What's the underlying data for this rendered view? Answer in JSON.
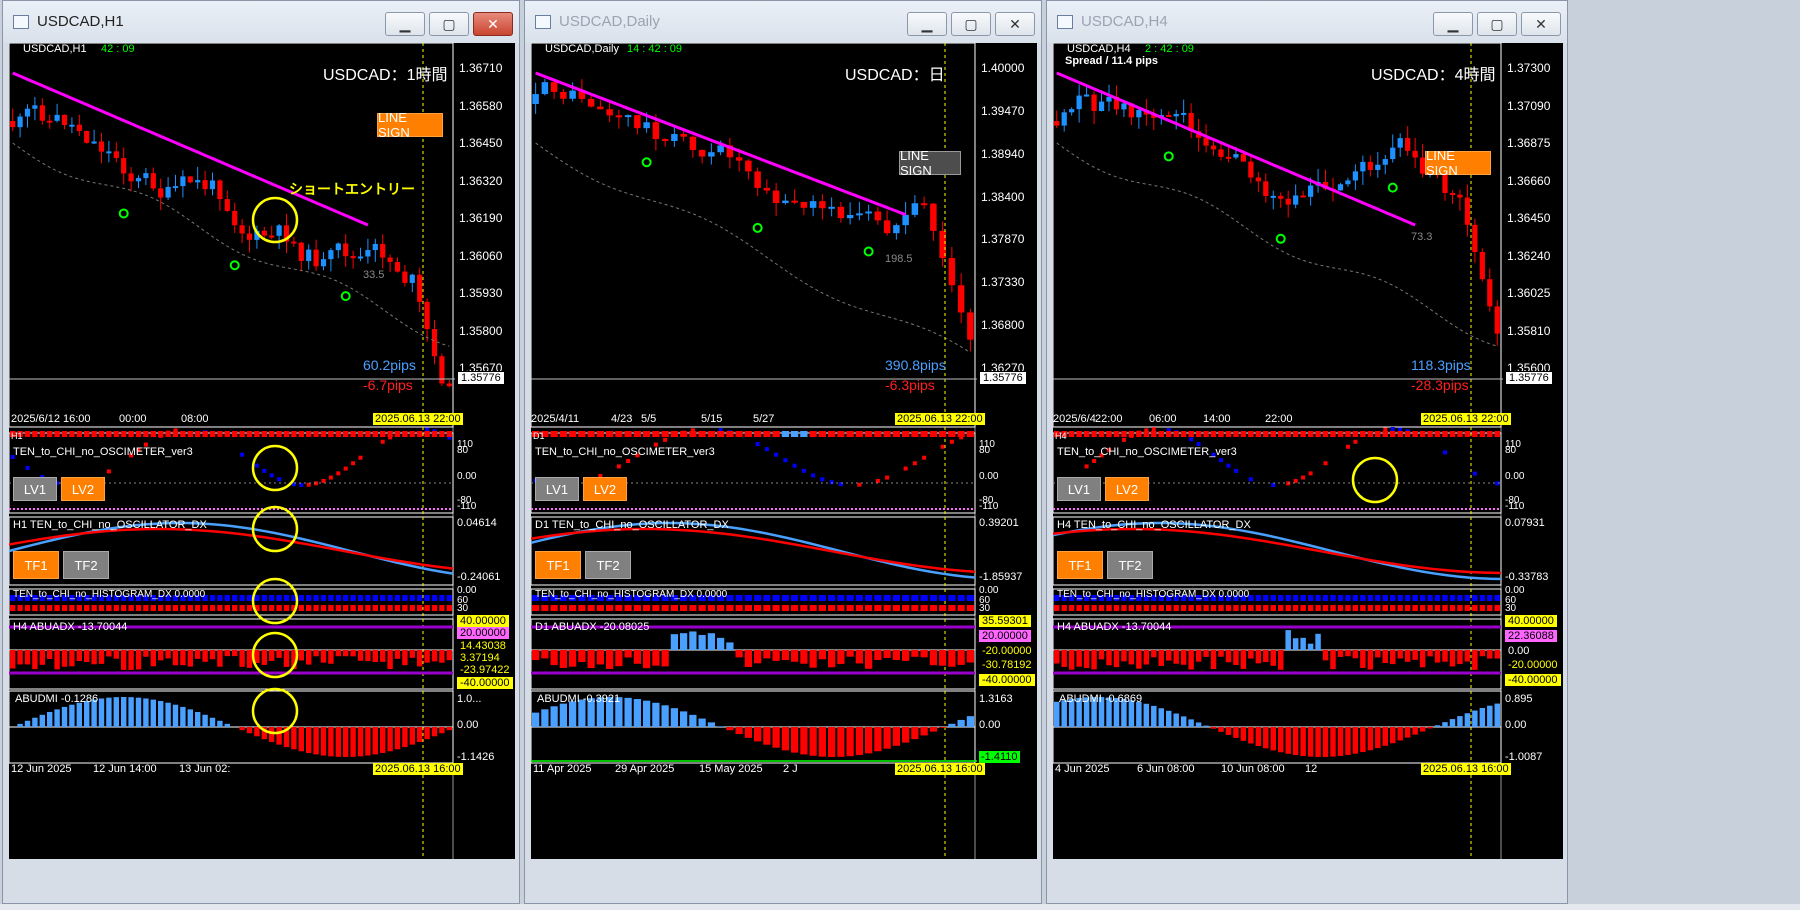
{
  "colors": {
    "bg": "#000000",
    "bull": "#1e90ff",
    "bear": "#ff0000",
    "ma": "#ff00ff",
    "date_highlight": "#ffff00",
    "lvl_btn": "#ff7f00",
    "gray_btn": "#808080"
  },
  "icons": [
    "window-icon",
    "minimize-icon",
    "maximize-icon",
    "close-icon"
  ],
  "windows": [
    {
      "title": "USDCAD,H1",
      "symbol": "USDCAD,H1",
      "timer": "42 : 09",
      "spread": "",
      "label": "USDCAD：1時間",
      "line_sign": "LINE SIGN",
      "line_sign_active": true,
      "yticks": [
        "1.36710",
        "1.36580",
        "1.36450",
        "1.36320",
        "1.36190",
        "1.36060",
        "1.35930",
        "1.35800",
        "1.35670"
      ],
      "price_box": "1.35776",
      "range_text": "33.5",
      "pips_blue": "60.2pips",
      "pips_red": "-6.7pips",
      "annotation": "ショートエントリー",
      "xticks": [
        "2025/6/12 16:00",
        "00:00",
        "08:00"
      ],
      "date_main": "2025.06.13 22:00",
      "tf_label": "H1",
      "osc_title": "TEN_to_CHI_no_OSCIMETER_ver3",
      "osc_yticks": [
        "110",
        "80",
        "0.00",
        "-80",
        "-110"
      ],
      "lv1": "LV1",
      "lv2": "LV2",
      "dx_title": "H1 TEN_to_CHI_no_OSCILLATOR_DX",
      "dx_yticks": [
        "0.04614",
        "-0.24061"
      ],
      "tf1": "TF1",
      "tf2": "TF2",
      "hist_title": "TEN_to_CHI_no_HISTOGRAM_DX 0.0000",
      "hist_yticks": [
        "0.00",
        "60",
        "30"
      ],
      "abu_title": "H4 ABUADX  -13.70044",
      "abu_labels": [
        "40.00000",
        "20.00000",
        "14.43038",
        "3.37194",
        "-23.97422",
        "-40.00000"
      ],
      "dmi_title": "ABUDMI  -0.1286",
      "dmi_yticks": [
        "1.0...",
        "0.00",
        "-1.1426"
      ],
      "bottom_xticks": [
        "12 Jun 2025",
        "12 Jun 14:00",
        "13 Jun 02:"
      ],
      "date_bottom": "2025.06.13 16:00"
    },
    {
      "title": "USDCAD,Daily",
      "symbol": "USDCAD,Daily",
      "timer": "14 : 42 : 09",
      "spread": "",
      "label": "USDCAD：日",
      "line_sign": "LINE SIGN",
      "line_sign_active": false,
      "yticks": [
        "1.40000",
        "1.39470",
        "1.38940",
        "1.38400",
        "1.37870",
        "1.37330",
        "1.36800",
        "1.36270"
      ],
      "price_box": "1.35776",
      "range_text": "198.5",
      "pips_blue": "390.8pips",
      "pips_red": "-6.3pips",
      "annotation": "",
      "xticks": [
        "2025/4/11",
        "4/23",
        "5/5",
        "5/15",
        "5/27"
      ],
      "date_main": "2025.06.13 22:00",
      "tf_label": "D1",
      "osc_title": "TEN_to_CHI_no_OSCIMETER_ver3",
      "osc_yticks": [
        "110",
        "80",
        "0.00",
        "-80",
        "-110"
      ],
      "lv1": "LV1",
      "lv2": "LV2",
      "dx_title": "D1 TEN_to_CHI_no_OSCILLATOR_DX",
      "dx_yticks": [
        "0.39201",
        "-1.85937"
      ],
      "tf1": "TF1",
      "tf2": "TF2",
      "hist_title": "TEN_to_CHI_no_HISTOGRAM_DX 0.0000",
      "hist_yticks": [
        "0.00",
        "60",
        "30"
      ],
      "abu_title": "D1 ABUADX  -20.08025",
      "abu_labels": [
        "35.59301",
        "20.00000",
        "-20.00000",
        "-30.78192",
        "-40.00000"
      ],
      "dmi_title": "ABUDMI  -0.3921",
      "dmi_yticks": [
        "1.3163",
        "0.00",
        "-1.4110"
      ],
      "bottom_xticks": [
        "11 Apr 2025",
        "29 Apr 2025",
        "15 May 2025",
        "2 J"
      ],
      "date_bottom": "2025.06.13 16:00"
    },
    {
      "title": "USDCAD,H4",
      "symbol": "USDCAD,H4",
      "timer": "2 : 42 : 09",
      "spread": "Spread / 11.4 pips",
      "label": "USDCAD：4時間",
      "line_sign": "LINE SIGN",
      "line_sign_active": true,
      "yticks": [
        "1.37300",
        "1.37090",
        "1.36875",
        "1.36660",
        "1.36450",
        "1.36240",
        "1.36025",
        "1.35810",
        "1.35600"
      ],
      "price_box": "1.35776",
      "range_text": "73.3",
      "pips_blue": "118.3pips",
      "pips_red": "-28.3pips",
      "annotation": "",
      "xticks": [
        "2025/6/4",
        "22:00",
        "06:00",
        "14:00",
        "22:00"
      ],
      "date_main": "2025.06.13 22:00",
      "tf_label": "H4",
      "osc_title": "TEN_to_CHI_no_OSCIMETER_ver3",
      "osc_yticks": [
        "110",
        "80",
        "0.00",
        "-80",
        "-110"
      ],
      "lv1": "LV1",
      "lv2": "LV2",
      "dx_title": "H4 TEN_to_CHI_no_OSCILLATOR_DX",
      "dx_yticks": [
        "0.07931",
        "-0.33783"
      ],
      "tf1": "TF1",
      "tf2": "TF2",
      "hist_title": "TEN_to_CHI_no_HISTOGRAM_DX 0.0000",
      "hist_yticks": [
        "0.00",
        "60",
        "30"
      ],
      "abu_title": "H4 ABUADX  -13.70044",
      "abu_labels": [
        "40.00000",
        "22.36088",
        "0.00",
        "-20.00000",
        "-40.00000"
      ],
      "dmi_title": "ABUDMI  -0.6869",
      "dmi_yticks": [
        "0.895",
        "0.00",
        "-1.0087"
      ],
      "bottom_xticks": [
        "4 Jun 2025",
        "6 Jun 08:00",
        "10 Jun 08:00",
        "12"
      ],
      "date_bottom": "2025.06.13 16:00"
    }
  ]
}
